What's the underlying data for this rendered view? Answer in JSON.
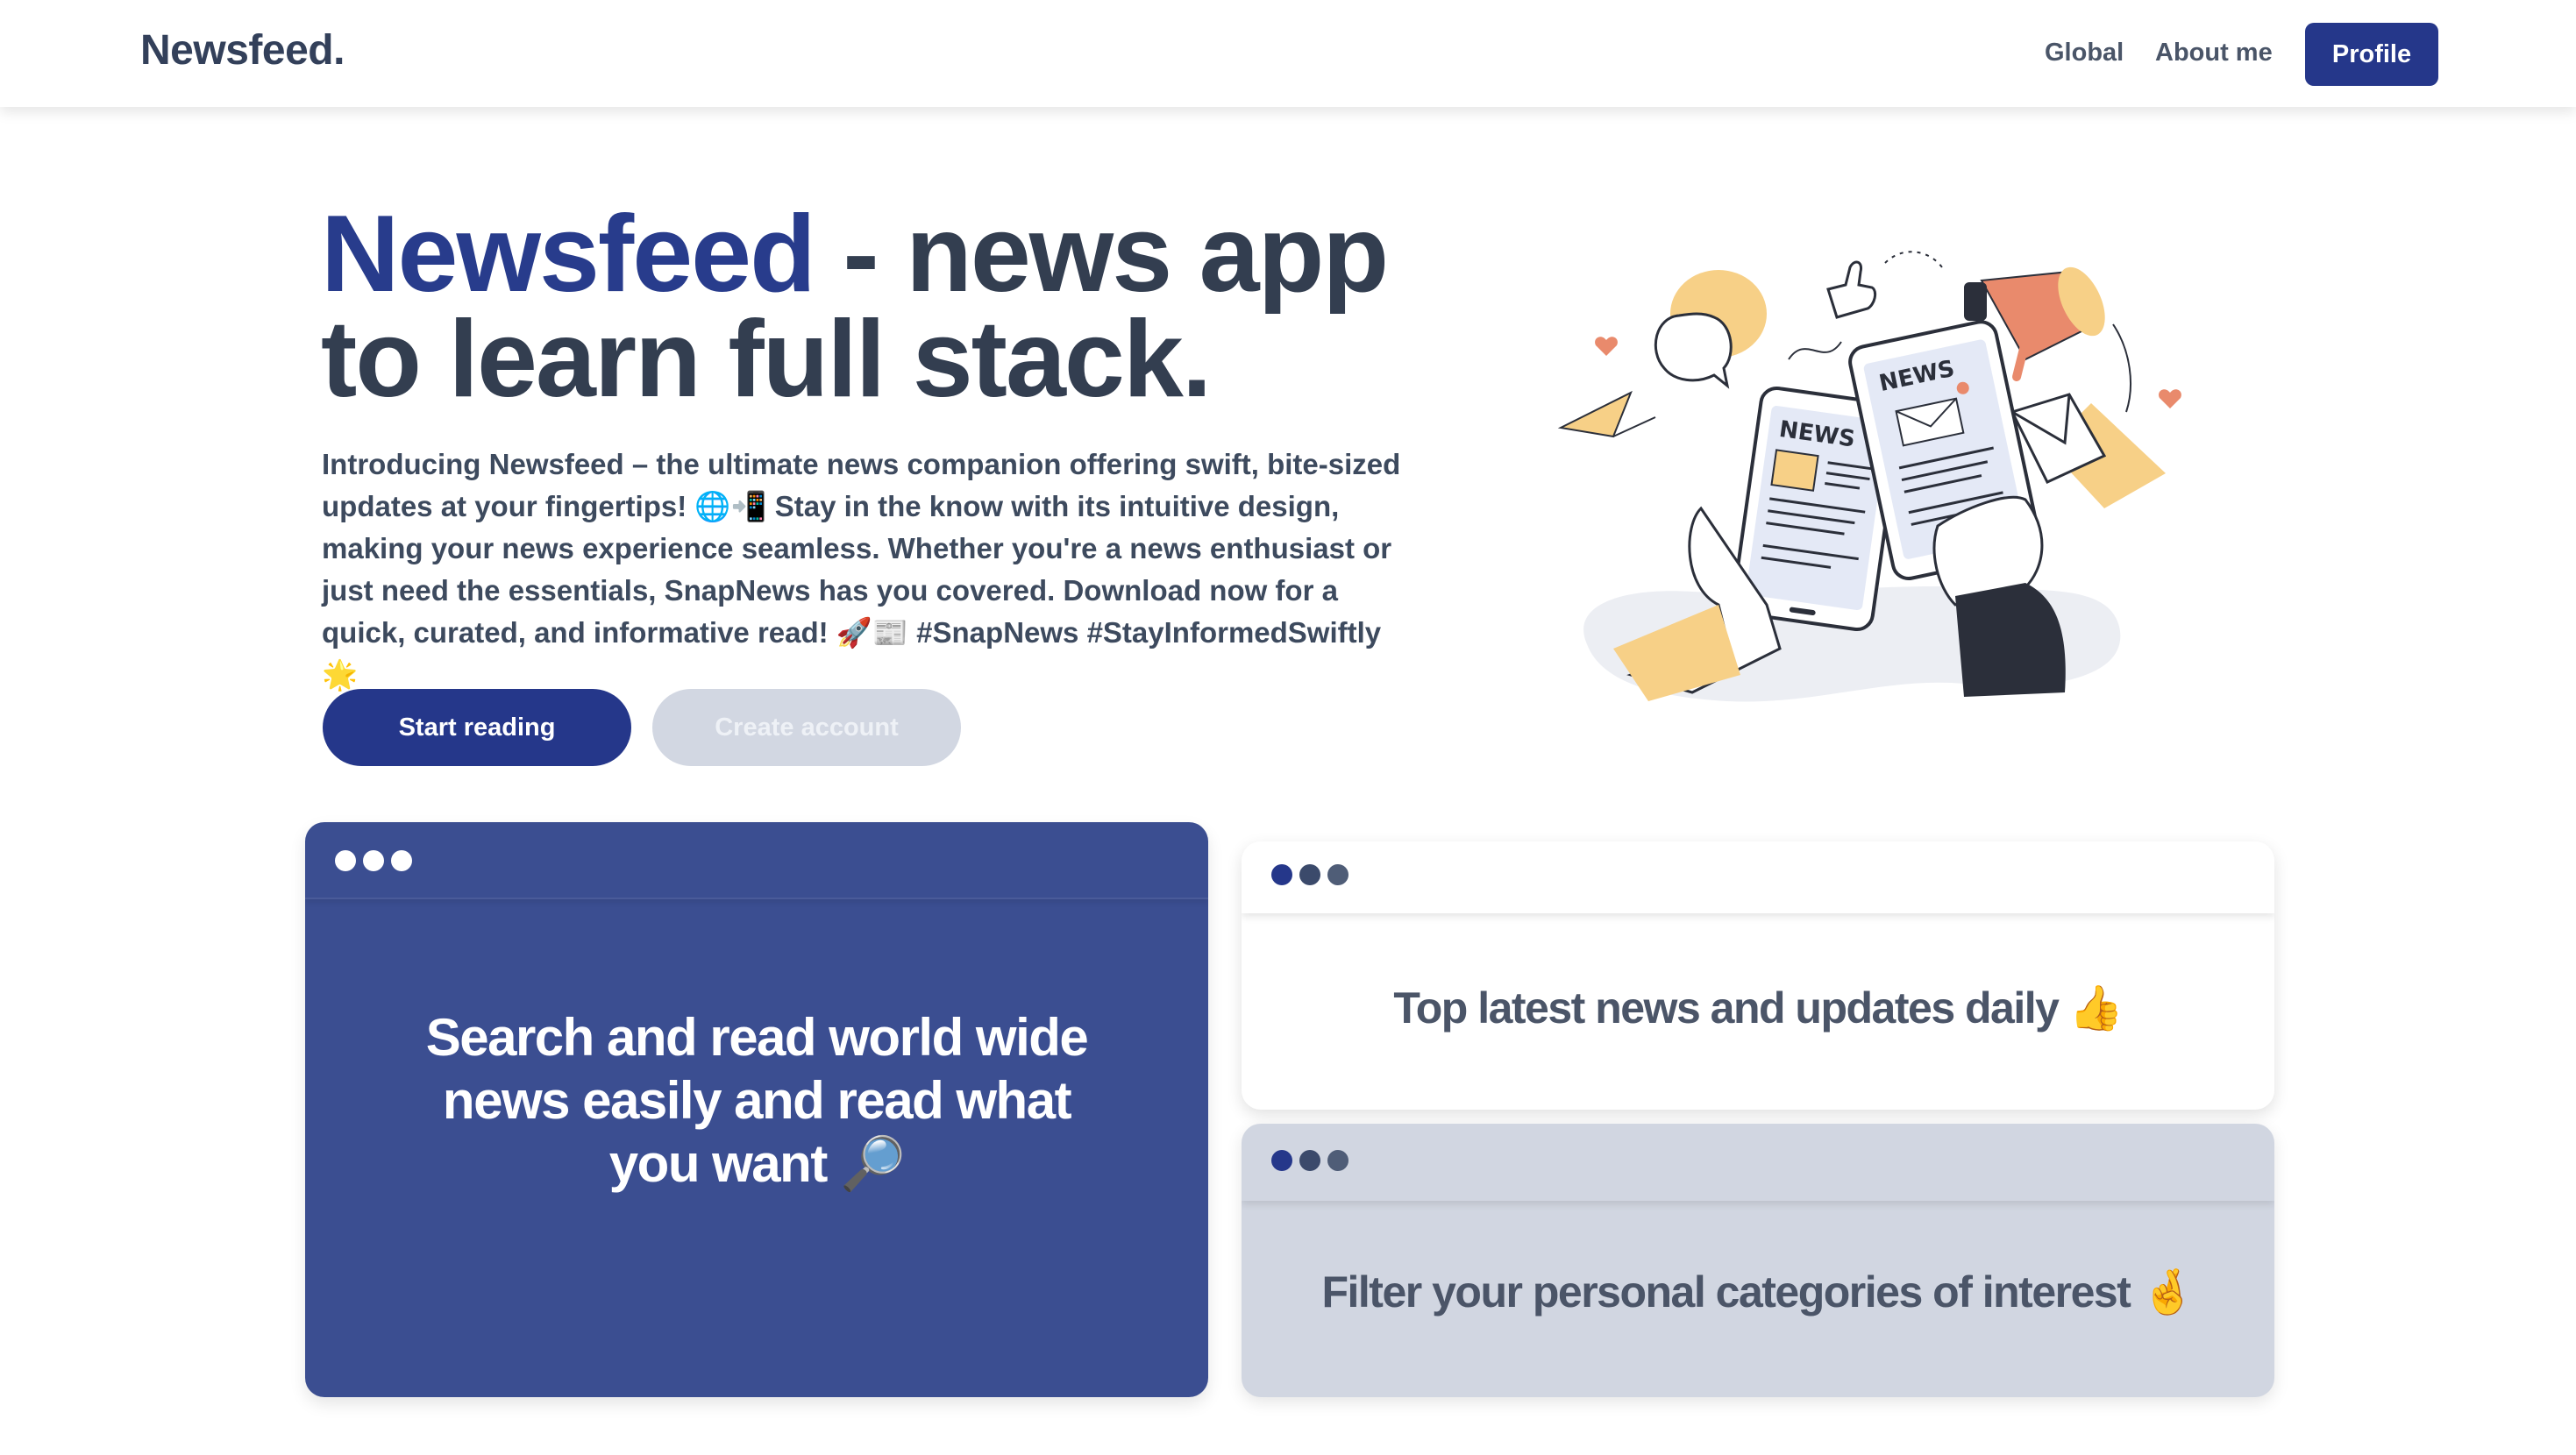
{
  "header": {
    "brand": "Newsfeed.",
    "nav": {
      "global": "Global",
      "about": "About me",
      "profile": "Profile"
    }
  },
  "hero": {
    "title_accent": "Newsfeed",
    "title_rest": " - news app to learn full stack.",
    "description": "Introducing Newsfeed – the ultimate news companion offering swift, bite-sized updates at your fingertips! 🌐📲 Stay in the know with its intuitive design, making your news experience seamless. Whether you're a news enthusiast or just need the essentials, SnapNews has you covered. Download now for a quick, curated, and informative read! 🚀📰 #SnapNews #StayInformedSwiftly 🌟",
    "start_button": "Start reading",
    "create_button": "Create account"
  },
  "illustration": {
    "left_phone_label": "NEWS",
    "right_phone_label": "NEWS"
  },
  "cards": {
    "search": "Search and read world wide news easily and read what you want 🔎",
    "latest": "Top latest news and updates daily 👍",
    "filter": "Filter your personal categories of interest 🤞"
  },
  "colors": {
    "primary": "#25378a",
    "card_blue": "#3b4e91",
    "card_gray": "#d1d6e1",
    "text_dark": "#333e50"
  }
}
